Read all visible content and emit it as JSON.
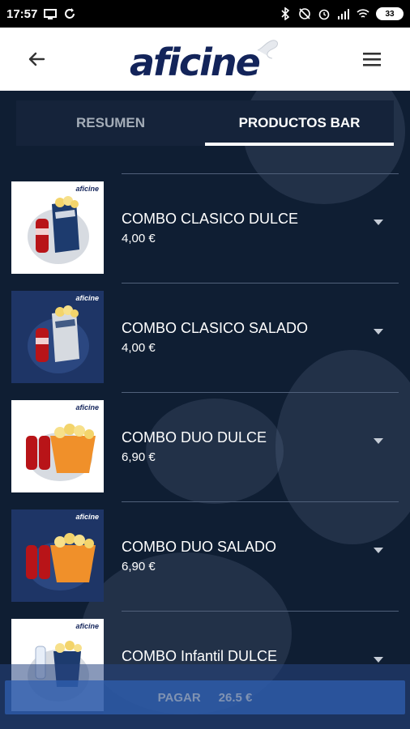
{
  "status_bar": {
    "time": "17:57",
    "battery": "33",
    "icons": [
      "screen-icon",
      "sync-icon",
      "bluetooth-icon",
      "dnd-icon",
      "alarm-icon",
      "signal-icon",
      "wifi-icon"
    ]
  },
  "header": {
    "logo_text": "aficine",
    "back_icon": "arrow-left-icon",
    "menu_icon": "hamburger-icon"
  },
  "tabs": [
    {
      "label": "RESUMEN",
      "active": false
    },
    {
      "label": "PRODUCTOS BAR",
      "active": true
    }
  ],
  "products": [
    {
      "name": "COMBO CLASICO DULCE",
      "price": "4,00 €",
      "thumb_bg": "#ffffff",
      "brand": "aficine"
    },
    {
      "name": "COMBO CLASICO SALADO",
      "price": "4,00 €",
      "thumb_bg": "#1e3566",
      "brand": "aficine"
    },
    {
      "name": "COMBO DUO DULCE",
      "price": "6,90 €",
      "thumb_bg": "#ffffff",
      "brand": "aficine"
    },
    {
      "name": "COMBO DUO SALADO",
      "price": "6,90 €",
      "thumb_bg": "#1e3566",
      "brand": "aficine"
    },
    {
      "name": "COMBO Infantil DULCE",
      "price": "",
      "thumb_bg": "#ffffff",
      "brand": "aficine"
    }
  ],
  "pay": {
    "label": "PAGAR",
    "amount": "26.5 €"
  },
  "colors": {
    "brand_navy": "#13245a",
    "background": "#0f1e33",
    "pay_button": "#2f5fb0"
  }
}
